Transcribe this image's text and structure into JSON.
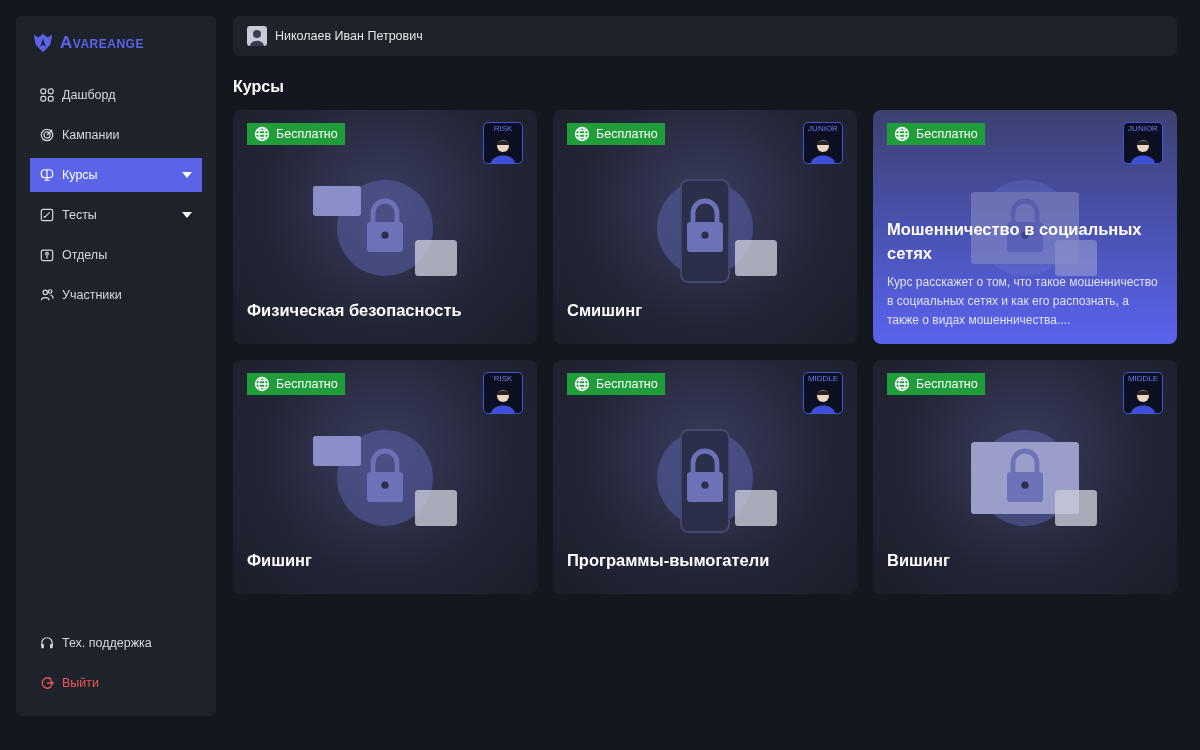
{
  "sidebar": {
    "logo": "Avareange",
    "items": [
      {
        "label": "Дашборд",
        "selected": false,
        "has_dropdown": false
      },
      {
        "label": "Кампании",
        "selected": false,
        "has_dropdown": false
      },
      {
        "label": "Курсы",
        "selected": true,
        "has_dropdown": true
      },
      {
        "label": "Тесты",
        "selected": false,
        "has_dropdown": true
      },
      {
        "label": "Отделы",
        "selected": false,
        "has_dropdown": false
      },
      {
        "label": "Участники",
        "selected": false,
        "has_dropdown": false
      }
    ],
    "footer": [
      {
        "label": "Тех. поддержка",
        "kind": "support"
      },
      {
        "label": "Выйти",
        "kind": "logout"
      }
    ]
  },
  "header": {
    "user_name": "Николаев Иван Петрович"
  },
  "page_title": "Курсы",
  "courses": [
    {
      "title": "Физическая безопасность",
      "price": "Бесплатно",
      "level_badge": "RISK",
      "hovered": false
    },
    {
      "title": "Смишинг",
      "price": "Бесплатно",
      "level_badge": "JUNIOR",
      "hovered": false
    },
    {
      "title": "Мошенничество в социальных сетях",
      "price": "Бесплатно",
      "level_badge": "JUNIOR",
      "hovered": true,
      "description": "Курс расскажет о том, что такое мошенничество в социальных сетях и как его распознать, а также о видах мошенничества...."
    },
    {
      "title": "Фишинг",
      "price": "Бесплатно",
      "level_badge": "RISK",
      "hovered": false
    },
    {
      "title": "Программы-вымогатели",
      "price": "Бесплатно",
      "level_badge": "MIDDLE",
      "hovered": false
    },
    {
      "title": "Вишинг",
      "price": "Бесплатно",
      "level_badge": "MIDDLE",
      "hovered": false
    }
  ]
}
